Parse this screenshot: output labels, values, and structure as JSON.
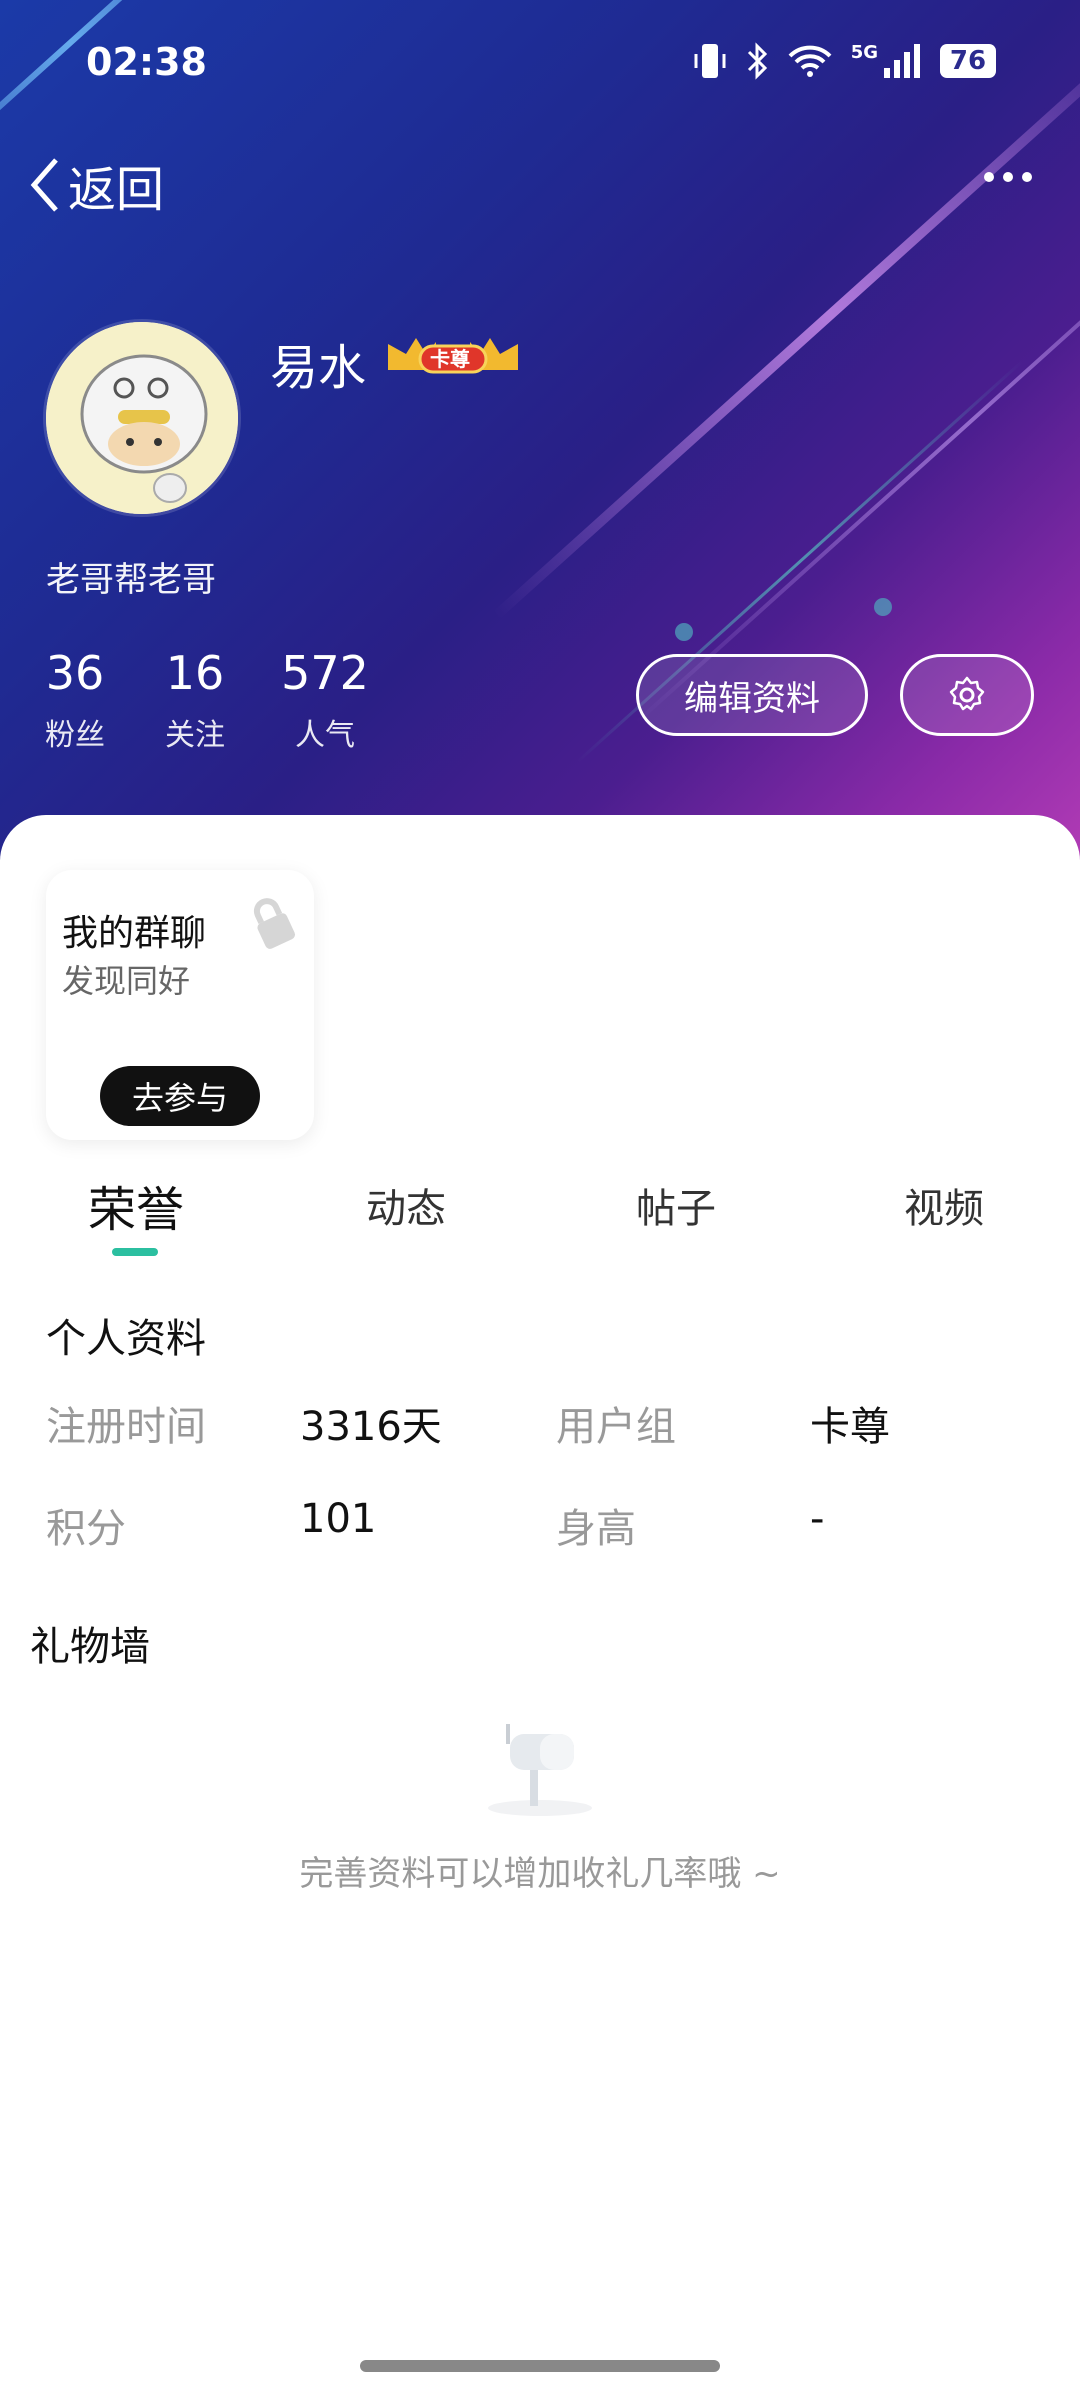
{
  "status_bar": {
    "time": "02:38",
    "battery": "76",
    "network": "5G"
  },
  "header": {
    "back_label": "返回"
  },
  "profile": {
    "username": "易水",
    "badge_label": "卡尊",
    "bio": "老哥帮老哥",
    "stats": [
      {
        "value": "36",
        "label": "粉丝"
      },
      {
        "value": "16",
        "label": "关注"
      },
      {
        "value": "572",
        "label": "人气"
      }
    ],
    "edit_label": "编辑资料"
  },
  "group_card": {
    "title": "我的群聊",
    "subtitle": "发现同好",
    "button": "去参与"
  },
  "tabs": [
    "荣誉",
    "动态",
    "帖子",
    "视频"
  ],
  "personal": {
    "title": "个人资料",
    "register_label": "注册时间",
    "register_value": "3316天",
    "group_label": "用户组",
    "group_value": "卡尊",
    "points_label": "积分",
    "points_value": "101",
    "height_label": "身高",
    "height_value": "-"
  },
  "gift_wall": {
    "title": "礼物墙",
    "empty_text": "完善资料可以增加收礼几率哦 ~"
  },
  "colors": {
    "accent": "#2bbfa0",
    "hero_start": "#1b3aa8",
    "hero_end": "#b13bb5"
  }
}
